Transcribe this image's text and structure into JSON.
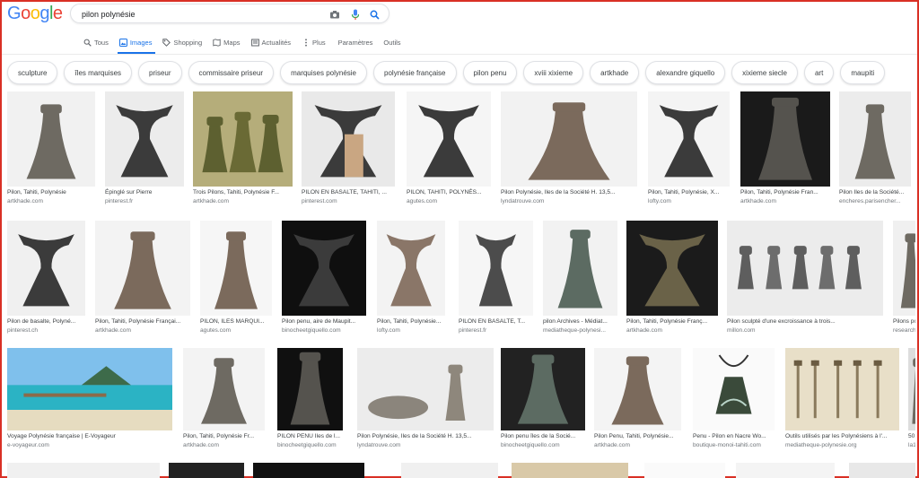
{
  "logo": {
    "letters": [
      "G",
      "o",
      "o",
      "g",
      "l",
      "e"
    ],
    "colors": [
      "#4285f4",
      "#ea4335",
      "#fbbc05",
      "#4285f4",
      "#34a853",
      "#ea4335"
    ]
  },
  "search": {
    "value": "pilon polynésie"
  },
  "tabs": [
    {
      "label": "Tous",
      "icon": "search-icon"
    },
    {
      "label": "Images",
      "icon": "image-icon",
      "active": true
    },
    {
      "label": "Shopping",
      "icon": "tag-icon"
    },
    {
      "label": "Maps",
      "icon": "map-icon"
    },
    {
      "label": "Actualités",
      "icon": "news-icon"
    },
    {
      "label": "Plus",
      "icon": "more-icon"
    },
    {
      "label": "Paramètres",
      "icon": ""
    },
    {
      "label": "Outils",
      "icon": ""
    }
  ],
  "chips": [
    "sculpture",
    "îles marquises",
    "priseur",
    "commissaire priseur",
    "marquises polynésie",
    "polynésie française",
    "pilon penu",
    "xviii xixieme",
    "artkhade",
    "alexandre giquello",
    "xixieme siecle",
    "art",
    "maupiti"
  ],
  "rows": [
    [
      {
        "caption": "Pilon, Tahiti, Polynésie",
        "source": "artkhade.com"
      },
      {
        "caption": "Épinglé sur Pierre",
        "source": "pinterest.fr"
      },
      {
        "caption": "Trois Pilons, Tahiti, Polynésie F...",
        "source": "artkhade.com"
      },
      {
        "caption": "PILON EN BASALTE, TAHITI, ...",
        "source": "pinterest.com"
      },
      {
        "caption": "PILON, TAHITI, POLYNÉS...",
        "source": "agutes.com"
      },
      {
        "caption": "Pilon Polynésie, Iles de la Société H. 13,5...",
        "source": "lyndatrouve.com"
      },
      {
        "caption": "Pilon, Tahiti, Polynésie, X...",
        "source": "lofty.com"
      },
      {
        "caption": "Pilon, Tahiti, Polynésie Fran...",
        "source": "artkhade.com"
      },
      {
        "caption": "Pilon Iles de la Société...",
        "source": "encheres.parisencher..."
      }
    ],
    [
      {
        "caption": "Pilon de basalte, Polyné...",
        "source": "pinterest.ch"
      },
      {
        "caption": "Pilon, Tahiti, Polynésie Françai...",
        "source": "artkhade.com"
      },
      {
        "caption": "PILON, ILES MARQUI...",
        "source": "agutes.com"
      },
      {
        "caption": "Pilon penu, aire de Maupit...",
        "source": "binocheetgiquello.com"
      },
      {
        "caption": "Pilon, Tahiti, Polynésie...",
        "source": "lofty.com"
      },
      {
        "caption": "PILON EN BASALTE, T...",
        "source": "pinterest.fr"
      },
      {
        "caption": "pilon Archives - Médiat...",
        "source": "mediatheque-polynesi..."
      },
      {
        "caption": "Pilon, Tahiti, Polynésie Franç...",
        "source": "artkhade.com"
      },
      {
        "caption": "Pilon sculpté d'une excroissance à trois...",
        "source": "millon.com"
      },
      {
        "caption": "Pilons po",
        "source": "research"
      }
    ],
    [
      {
        "caption": "Voyage Polynésie française | E-Voyageur",
        "source": "e-voyageur.com"
      },
      {
        "caption": "Pilon, Tahiti, Polynésie Fr...",
        "source": "artkhade.com"
      },
      {
        "caption": "PILON PENU Iles de l...",
        "source": "binocheetgiquello.com"
      },
      {
        "caption": "Pilon Polynésie, Iles de la Société H. 13,5...",
        "source": "lyndatrouve.com"
      },
      {
        "caption": "Pilon penu îles de la Socié...",
        "source": "binocheetgiquello.com"
      },
      {
        "caption": "Pilon Penu, Tahiti, Polynésie...",
        "source": "artkhade.com"
      },
      {
        "caption": "Penu - Pilon en Nacre Wo...",
        "source": "boutique-monoi-tahiti.com"
      },
      {
        "caption": "Outils utilisés par les Polynésiens à l'...",
        "source": "mediatheque-polynesie.org"
      },
      {
        "caption": "50",
        "source": "la1"
      }
    ]
  ]
}
